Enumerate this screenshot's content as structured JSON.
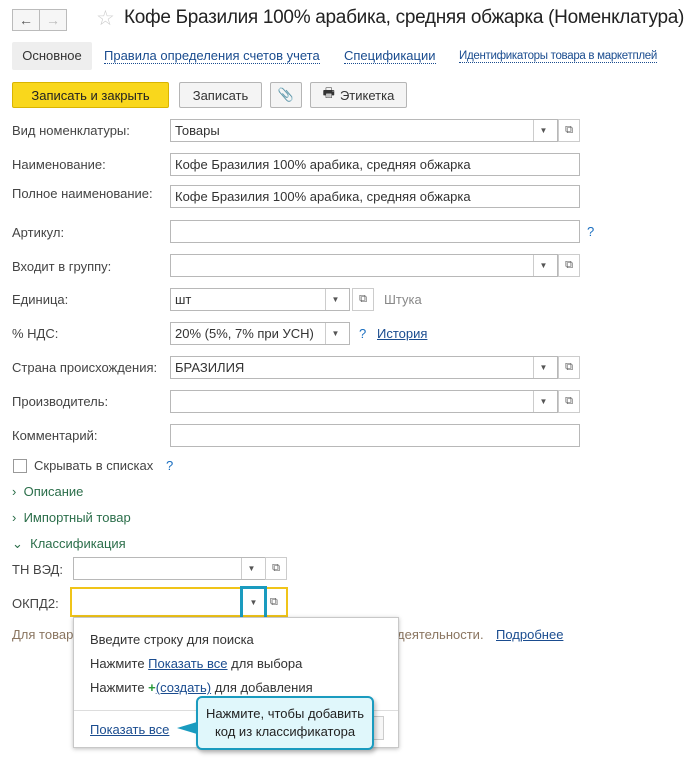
{
  "window": {
    "title": "Кофе Бразилия 100% арабика, средняя обжарка (Номенклатура)"
  },
  "tabs": [
    "Основное",
    "Правила определения счетов учета",
    "Спецификации",
    "Идентификаторы товара в маркетплей"
  ],
  "toolbar": {
    "save_close": "Записать и закрыть",
    "save": "Записать",
    "label": "Этикетка"
  },
  "fields": {
    "kind": {
      "label": "Вид номенклатуры:",
      "value": "Товары"
    },
    "name": {
      "label": "Наименование:",
      "value": "Кофе Бразилия 100% арабика, средняя обжарка"
    },
    "full_name": {
      "label": "Полное наименование:",
      "value": "Кофе Бразилия 100% арабика, средняя обжарка"
    },
    "article": {
      "label": "Артикул:",
      "value": ""
    },
    "group": {
      "label": "Входит в группу:",
      "value": ""
    },
    "unit": {
      "label": "Единица:",
      "value": "шт",
      "hint": "Штука"
    },
    "vat": {
      "label": "% НДС:",
      "value": "20% (5%, 7% при УСН)",
      "history": "История"
    },
    "country": {
      "label": "Страна происхождения:",
      "value": "БРАЗИЛИЯ"
    },
    "manufacturer": {
      "label": "Производитель:",
      "value": ""
    },
    "comment": {
      "label": "Комментарий:",
      "value": ""
    }
  },
  "hide_in_lists": {
    "label": "Скрывать в списках",
    "checked": false
  },
  "help": "?",
  "groups": {
    "description": "Описание",
    "import": "Импортный товар",
    "classification": "Классификация"
  },
  "classification": {
    "tnved": "ТН ВЭД:",
    "okpd2": "ОКПД2:",
    "hint_left": "Для товар",
    "hint_right": "деятельности.",
    "more": "Подробнее"
  },
  "dropdown": {
    "line1": "Введите строку для поиска",
    "line2_pre": "Нажмите ",
    "line2_link": "Показать все",
    "line2_post": " для выбора",
    "line3_pre": "Нажмите ",
    "line3_link": "(создать)",
    "line3_post": " для добавления",
    "show_all": "Показать все"
  },
  "tooltip": "Нажмите, чтобы добавить код из классификатора",
  "colors": {
    "primary_button": "#f9d71c",
    "focus": "#f0c419",
    "highlight": "#1a9bbf",
    "tooltip_bg": "#e0f7fb"
  }
}
